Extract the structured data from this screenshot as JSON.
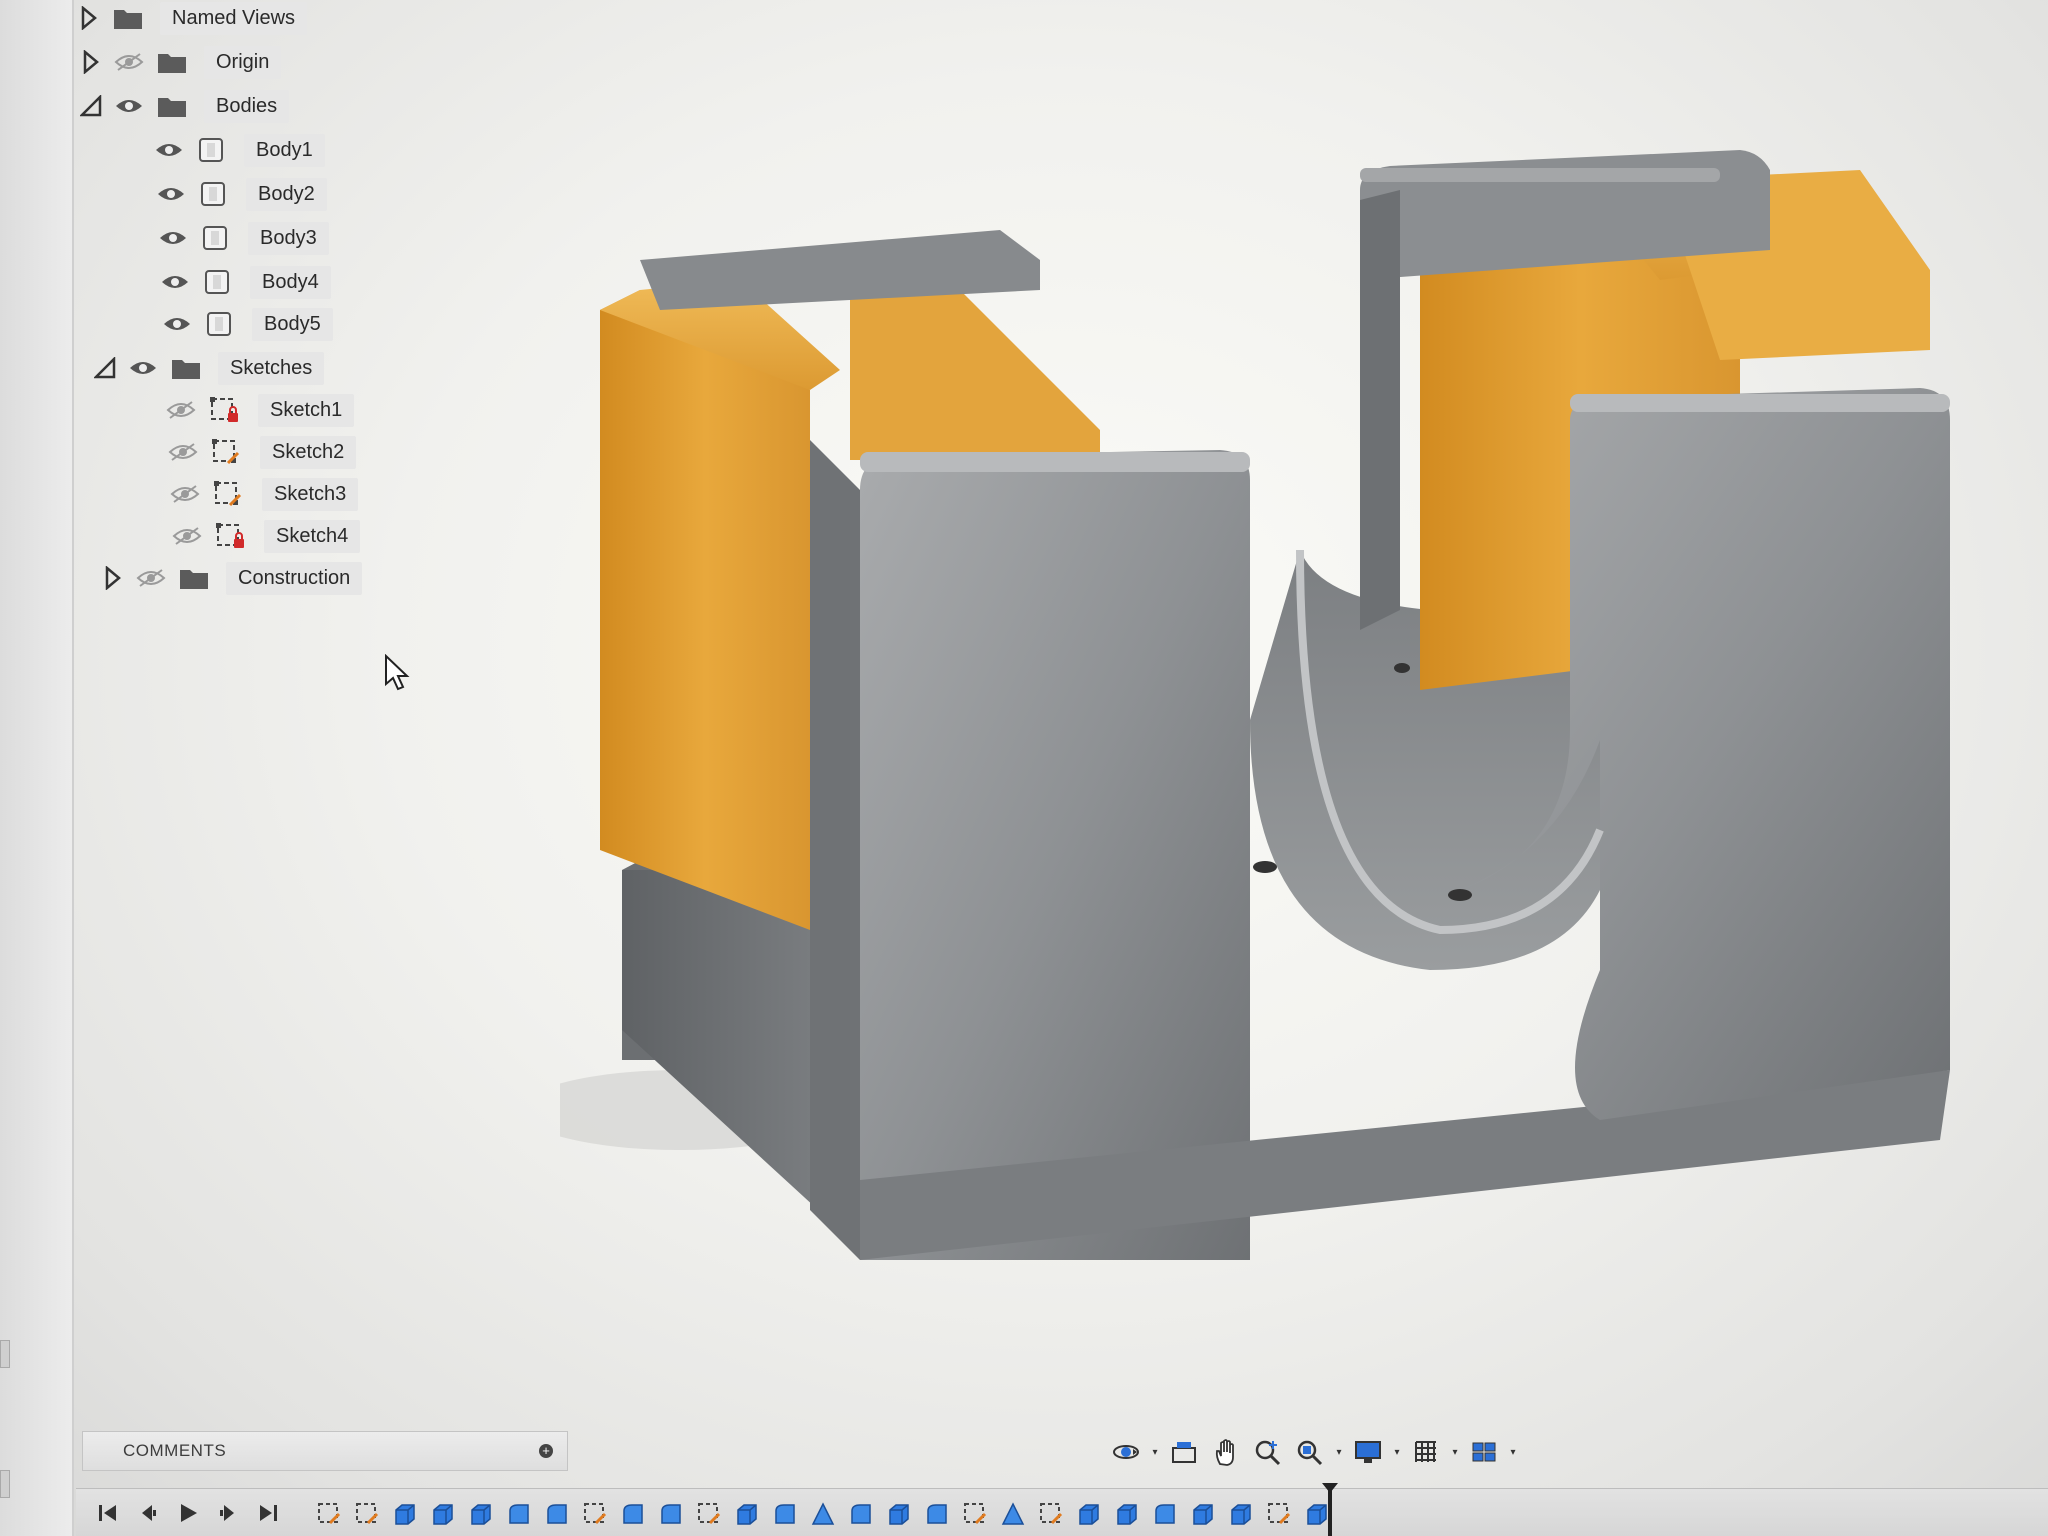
{
  "browser": {
    "items": [
      {
        "label": "Named Views",
        "kind": "folder",
        "expander": "collapsed",
        "visibility": "none"
      },
      {
        "label": "Origin",
        "kind": "folder",
        "expander": "collapsed",
        "visibility": "hidden"
      },
      {
        "label": "Bodies",
        "kind": "folder",
        "expander": "expanded",
        "visibility": "visible"
      },
      {
        "label": "Body1",
        "kind": "body",
        "visibility": "visible"
      },
      {
        "label": "Body2",
        "kind": "body",
        "visibility": "visible"
      },
      {
        "label": "Body3",
        "kind": "body",
        "visibility": "visible"
      },
      {
        "label": "Body4",
        "kind": "body",
        "visibility": "visible"
      },
      {
        "label": "Body5",
        "kind": "body",
        "visibility": "visible"
      },
      {
        "label": "Sketches",
        "kind": "folder",
        "expander": "expanded",
        "visibility": "visible"
      },
      {
        "label": "Sketch1",
        "kind": "sketch",
        "visibility": "hidden",
        "badge": "lock"
      },
      {
        "label": "Sketch2",
        "kind": "sketch",
        "visibility": "hidden",
        "badge": "pencil"
      },
      {
        "label": "Sketch3",
        "kind": "sketch",
        "visibility": "hidden",
        "badge": "pencil"
      },
      {
        "label": "Sketch4",
        "kind": "sketch",
        "visibility": "hidden",
        "badge": "lock"
      },
      {
        "label": "Construction",
        "kind": "folder",
        "expander": "collapsed",
        "visibility": "hidden"
      }
    ]
  },
  "comments": {
    "title": "COMMENTS",
    "add_symbol": "+"
  },
  "nav_toolbar": {
    "icons": [
      "orbit-icon",
      "look-at-icon",
      "pan-icon",
      "zoom-icon",
      "fit-icon",
      "display-settings-icon",
      "grid-icon",
      "viewports-icon"
    ]
  },
  "timeline": {
    "controls": [
      "go-to-start-icon",
      "step-back-icon",
      "play-icon",
      "step-forward-icon",
      "go-to-end-icon"
    ],
    "features": [
      "sketch",
      "sketch",
      "extrude",
      "extrude",
      "extrude",
      "fillet",
      "fillet",
      "sketch",
      "fillet",
      "fillet",
      "sketch",
      "extrude",
      "fillet",
      "draft",
      "fillet",
      "extrude",
      "fillet",
      "sketch",
      "draft",
      "sketch",
      "extrude",
      "extrude",
      "fillet",
      "extrude",
      "extrude",
      "sketch",
      "extrude"
    ]
  },
  "colors": {
    "body_gray": "#8d9093",
    "body_orange": "#e3a63a",
    "background": "#f1f1ee"
  }
}
